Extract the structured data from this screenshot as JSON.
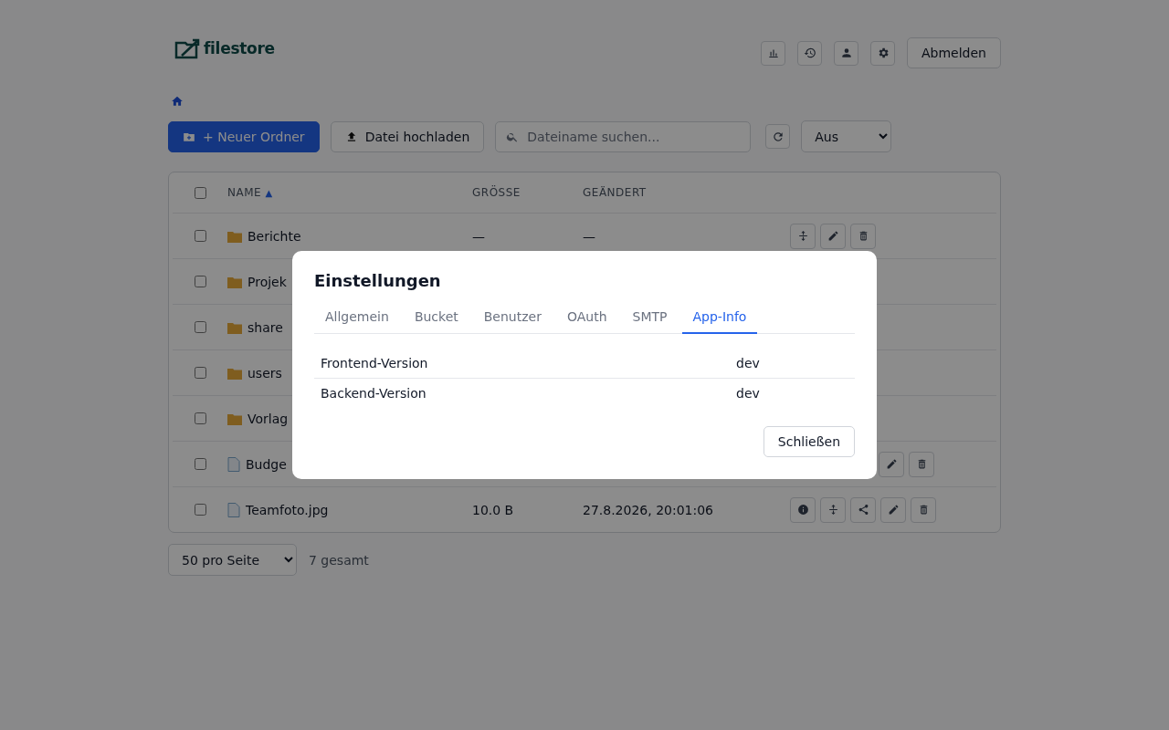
{
  "header": {
    "logo": "filestore",
    "icon_buttons": [
      {
        "kind": "stats"
      },
      {
        "kind": "history"
      },
      {
        "kind": "user"
      },
      {
        "kind": "settings"
      }
    ],
    "logout": "Abmelden"
  },
  "toolbar": {
    "new_folder": "+ Neuer Ordner",
    "upload": "Datei hochladen",
    "search": {
      "placeholder": "Dateiname suchen..."
    },
    "filter": "Aus"
  },
  "table": {
    "all_selected": false,
    "columns": [
      {
        "label": "NAME",
        "sort": "▲"
      },
      {
        "label": "GRÖSSE"
      },
      {
        "label": "GEÄNDERT"
      }
    ],
    "rows": [
      {
        "kind": "folder",
        "name": "Berichte",
        "size": "—",
        "modified": "—",
        "checked": false,
        "actions": [
          {
            "kind": "move"
          },
          {
            "kind": "edit"
          },
          {
            "kind": "delete"
          }
        ]
      },
      {
        "kind": "folder",
        "name": "Projek",
        "checked": false,
        "actions": []
      },
      {
        "kind": "folder",
        "name": "share",
        "checked": false,
        "actions": []
      },
      {
        "kind": "folder",
        "name": "users",
        "checked": false,
        "actions": []
      },
      {
        "kind": "folder",
        "name": "Vorlag",
        "checked": false,
        "actions": []
      },
      {
        "kind": "file",
        "name": "Budge",
        "checked": false,
        "actions": [
          {
            "kind": "edit"
          },
          {
            "kind": "delete"
          }
        ]
      },
      {
        "kind": "file",
        "name": "Teamfoto.jpg",
        "size": "10.0 B",
        "modified": "27.8.2026, 20:01:06",
        "checked": false,
        "actions": [
          {
            "kind": "info"
          },
          {
            "kind": "move"
          },
          {
            "kind": "share"
          },
          {
            "kind": "edit"
          },
          {
            "kind": "delete"
          }
        ]
      }
    ]
  },
  "footer": {
    "page_size": "50 pro Seite",
    "total": "7 gesamt"
  },
  "dialog": {
    "title": "Einstellungen",
    "tabs": [
      {
        "label": "Allgemein",
        "selected": false
      },
      {
        "label": "Bucket",
        "selected": false
      },
      {
        "label": "Benutzer",
        "selected": false
      },
      {
        "label": "OAuth",
        "selected": false
      },
      {
        "label": "SMTP",
        "selected": false
      },
      {
        "label": "App-Info",
        "selected": true
      }
    ],
    "info": [
      {
        "label": "Frontend-Version",
        "value": "dev"
      },
      {
        "label": "Backend-Version",
        "value": "dev"
      }
    ],
    "close": "Schließen"
  }
}
